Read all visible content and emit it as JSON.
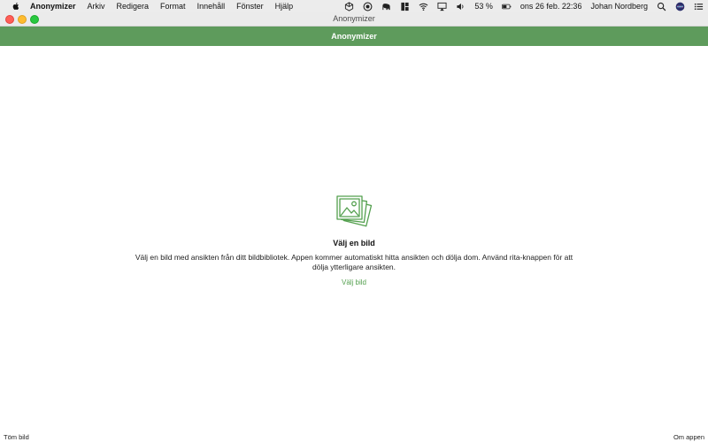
{
  "menubar": {
    "app_name": "Anonymizer",
    "items": [
      "Arkiv",
      "Redigera",
      "Format",
      "Innehåll",
      "Fönster",
      "Hjälp"
    ],
    "battery": "53 %",
    "clock": "ons 26 feb.  22:36",
    "user": "Johan Nordberg",
    "icons": [
      "cube-icon",
      "circle-icon",
      "elephant-icon",
      "notch-icon",
      "wifi-icon",
      "airplay-icon",
      "volume-icon",
      "battery-icon",
      "search-icon",
      "siri-icon",
      "list-icon"
    ]
  },
  "window": {
    "title": "Anonymizer"
  },
  "header": {
    "title": "Anonymizer",
    "color": "#5e9b5c"
  },
  "empty_state": {
    "heading": "Välj en bild",
    "description": "Välj en bild med ansikten från ditt bildbibliotek. Appen kommer automatiskt hitta ansikten och dölja dom. Använd rita-knappen för att dölja ytterligare ansikten.",
    "action": "Välj bild",
    "icon": "photo-stack-icon",
    "accent": "#54a04f"
  },
  "footer": {
    "left": "Töm bild",
    "right": "Om appen"
  }
}
